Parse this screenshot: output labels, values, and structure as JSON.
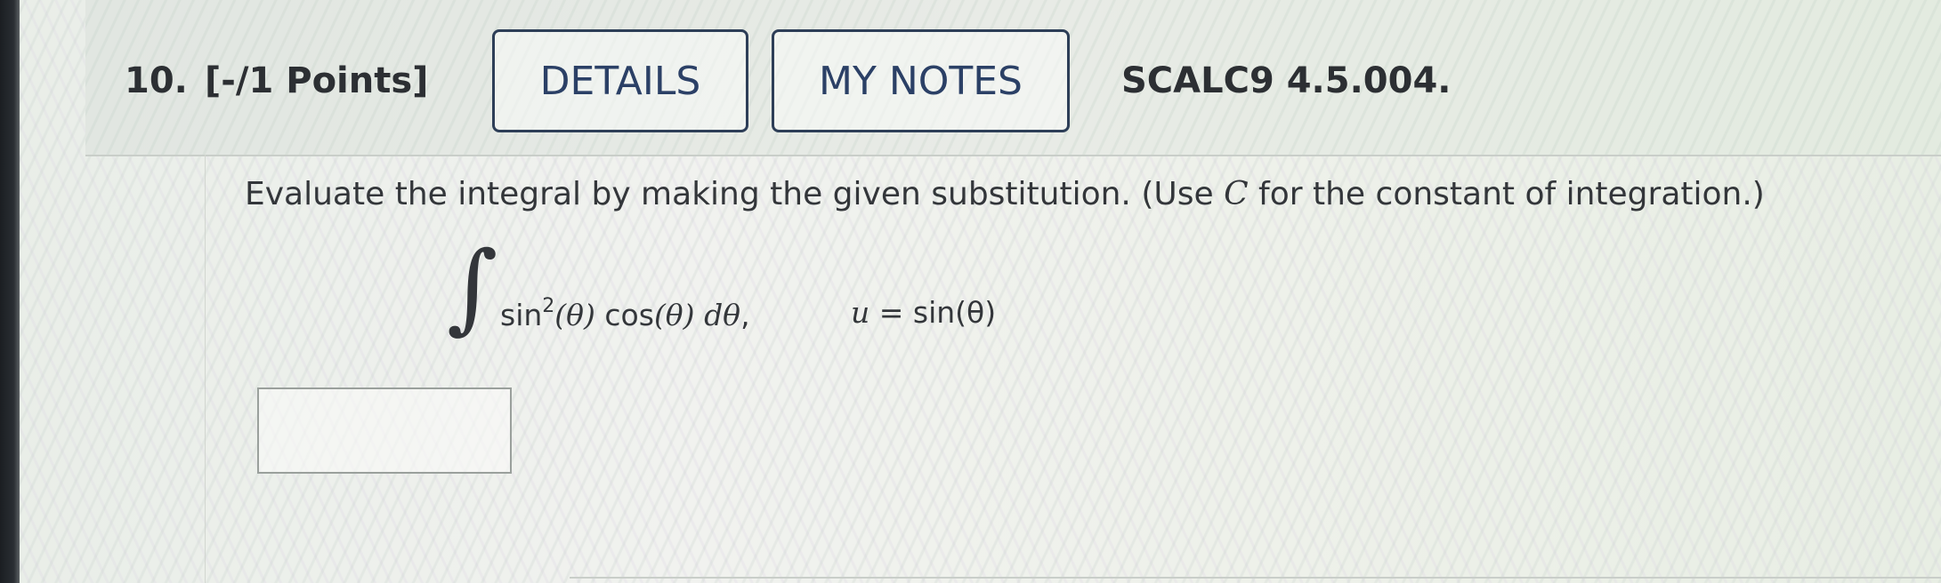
{
  "question": {
    "number": "10.",
    "points": "[-/1 Points]",
    "details_label": "DETAILS",
    "notes_label": "MY NOTES",
    "reference": "SCALC9 4.5.004."
  },
  "problem": {
    "instruction_before": "Evaluate the integral by making the given substitution. (Use ",
    "instruction_var": "C",
    "instruction_after": " for the constant of integration.)",
    "integral_sign": "∫",
    "integrand_sin": "sin",
    "integrand_exponent": "2",
    "integrand_theta1": "(θ)",
    "integrand_cos": "cos",
    "integrand_theta2": "(θ)",
    "integrand_d": "dθ",
    "integrand_comma": ",",
    "sub_var": "u",
    "sub_rhs": " = sin(θ)"
  },
  "answer": {
    "value": ""
  }
}
